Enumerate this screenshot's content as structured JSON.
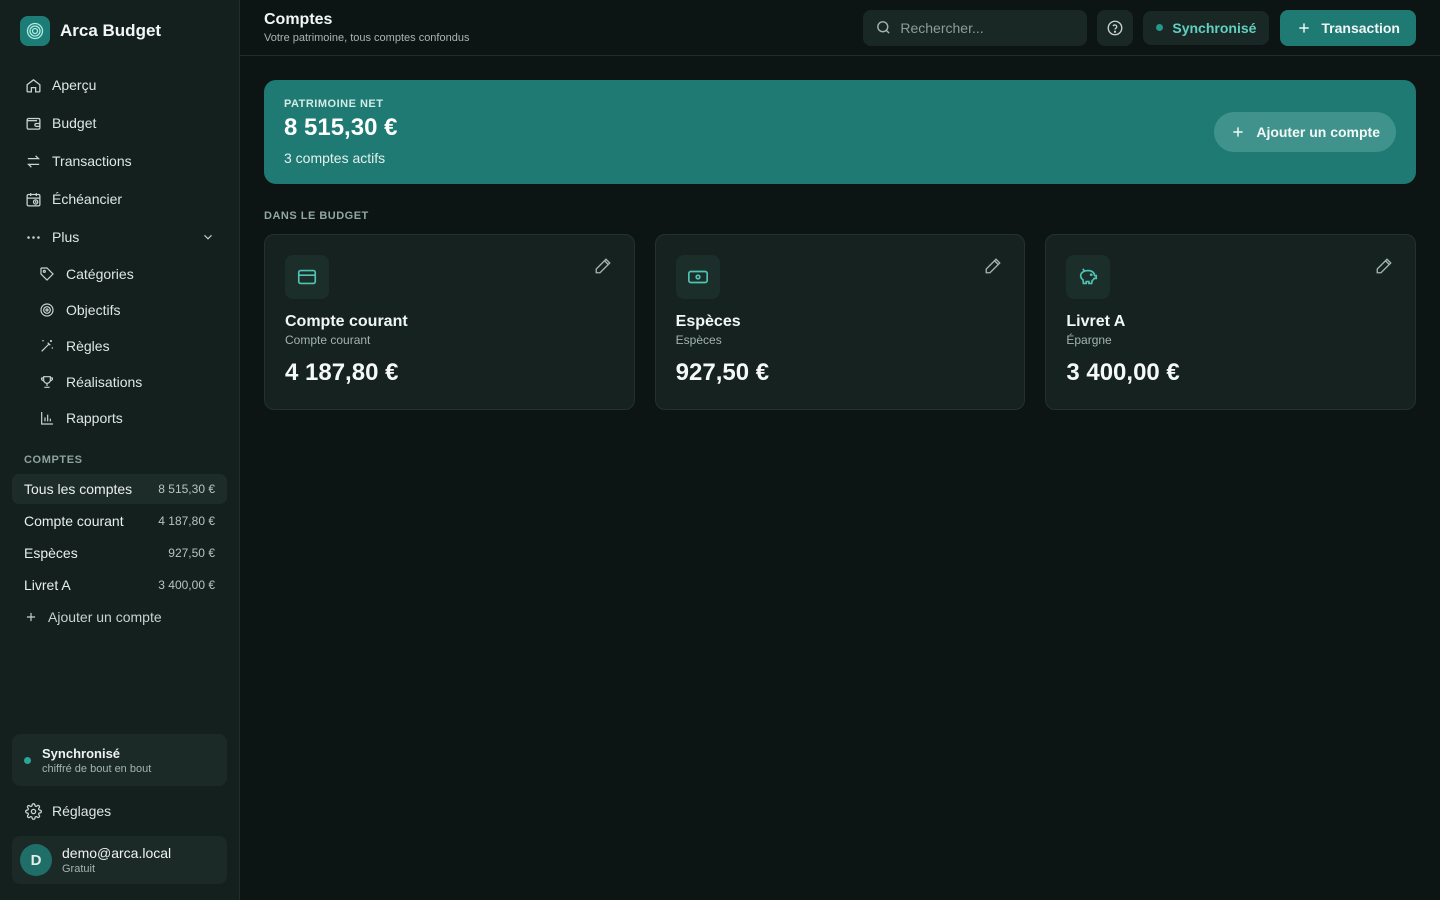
{
  "brand": {
    "name": "Arca Budget"
  },
  "nav": {
    "items": [
      {
        "label": "Aperçu"
      },
      {
        "label": "Budget"
      },
      {
        "label": "Transactions"
      },
      {
        "label": "Échéancier"
      },
      {
        "label": "Plus"
      }
    ],
    "sub": [
      {
        "label": "Catégories"
      },
      {
        "label": "Objectifs"
      },
      {
        "label": "Règles"
      },
      {
        "label": "Réalisations"
      },
      {
        "label": "Rapports"
      }
    ]
  },
  "accounts": {
    "section_label": "COMPTES",
    "items": [
      {
        "label": "Tous les comptes",
        "amount": "8 515,30 €"
      },
      {
        "label": "Compte courant",
        "amount": "4 187,80 €"
      },
      {
        "label": "Espèces",
        "amount": "927,50 €"
      },
      {
        "label": "Livret A",
        "amount": "3 400,00 €"
      }
    ],
    "add_label": "Ajouter un compte"
  },
  "sync": {
    "title": "Synchronisé",
    "subtitle": "chiffré de bout en bout"
  },
  "settings": {
    "label": "Réglages"
  },
  "user": {
    "initial": "D",
    "email": "demo@arca.local",
    "plan": "Gratuit"
  },
  "header": {
    "title": "Comptes",
    "subtitle": "Votre patrimoine, tous comptes confondus",
    "search_placeholder": "Rechercher...",
    "sync_label": "Synchronisé",
    "transaction_label": "Transaction"
  },
  "hero": {
    "label": "PATRIMOINE NET",
    "amount": "8 515,30 €",
    "subtitle": "3 comptes actifs",
    "add_button": "Ajouter un compte"
  },
  "budget": {
    "section_label": "DANS LE BUDGET",
    "cards": [
      {
        "name": "Compte courant",
        "type": "Compte courant",
        "amount": "4 187,80 €",
        "icon": "credit-card-icon"
      },
      {
        "name": "Espèces",
        "type": "Espèces",
        "amount": "927,50 €",
        "icon": "banknote-icon"
      },
      {
        "name": "Livret A",
        "type": "Épargne",
        "amount": "3 400,00 €",
        "icon": "piggy-bank-icon"
      }
    ]
  },
  "colors": {
    "accent": "#1e7a73",
    "accent_text": "#5fd0c1",
    "background": "#0c1513",
    "sidebar": "#13201d"
  }
}
